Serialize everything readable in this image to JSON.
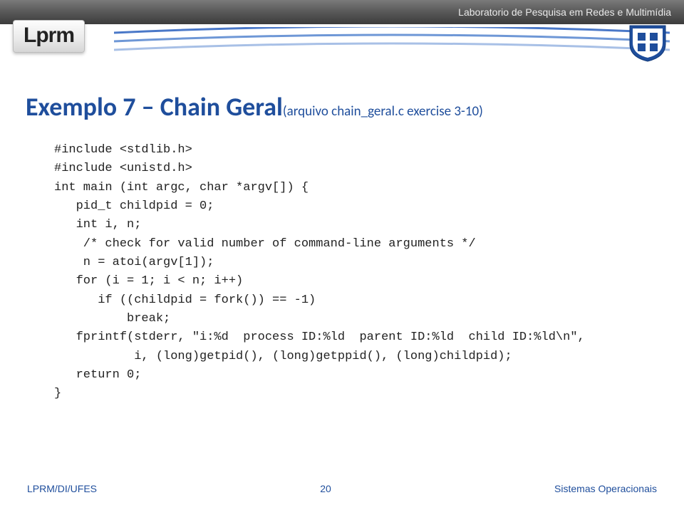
{
  "header": {
    "lab_name": "Laboratorio de Pesquisa em Redes e Multimídia",
    "logo_text": "Lprm"
  },
  "title": {
    "main": "Exemplo 7 – Chain Geral",
    "sub": "(arquivo chain_geral.c exercise 3-10)"
  },
  "code": {
    "l01": "#include <stdlib.h>",
    "l02": "#include <unistd.h>",
    "l03": "int main (int argc, char *argv[]) {",
    "l04": "   pid_t childpid = 0;",
    "l05": "   int i, n;",
    "l06": "    /* check for valid number of command-line arguments */",
    "l07": "    n = atoi(argv[1]);",
    "l08": "   for (i = 1; i < n; i++)",
    "l09": "      if ((childpid = fork()) == -1)",
    "l10": "          break;",
    "l11": "   fprintf(stderr, \"i:%d  process ID:%ld  parent ID:%ld  child ID:%ld\\n\",",
    "l12": "           i, (long)getpid(), (long)getppid(), (long)childpid);",
    "l13": "   return 0;",
    "l14": "}"
  },
  "footer": {
    "left": "LPRM/DI/UFES",
    "page": "20",
    "right": "Sistemas Operacionais"
  }
}
